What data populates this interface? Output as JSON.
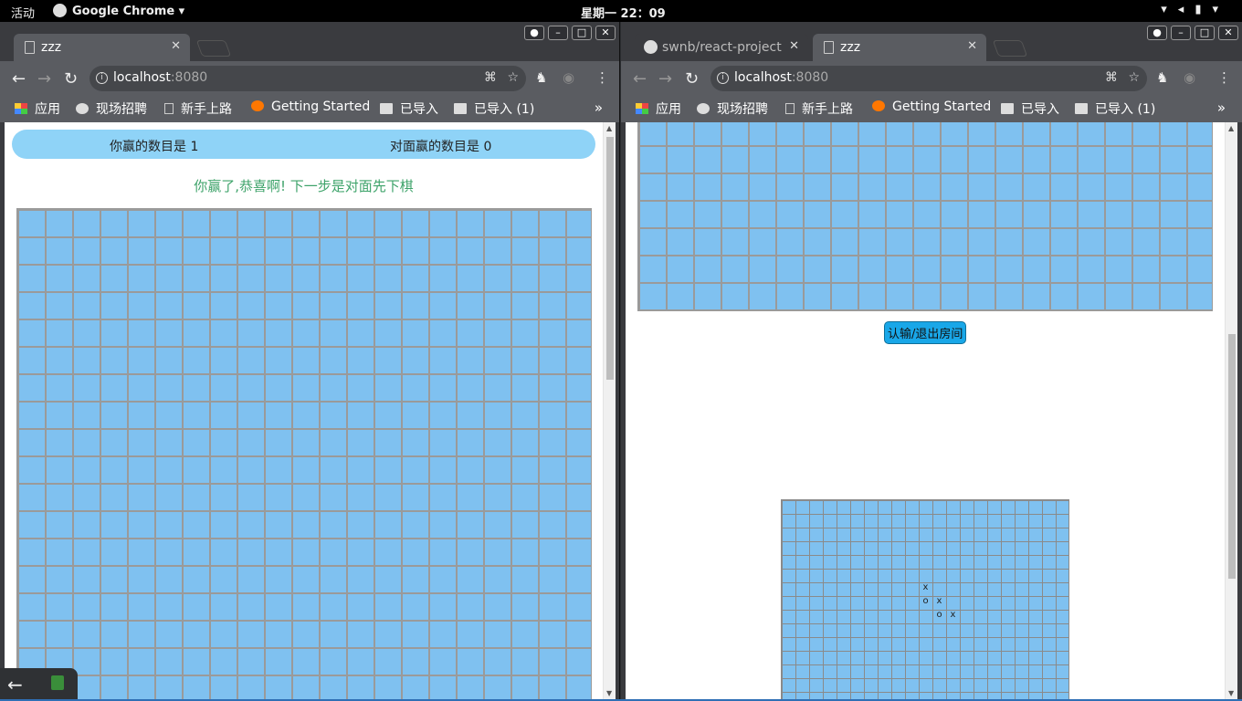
{
  "topbar": {
    "activities": "活动",
    "app_name": "Google Chrome",
    "clock": "星期一 22：09"
  },
  "left_window": {
    "tab": {
      "title": "zzz"
    },
    "url": {
      "host": "localhost",
      "port": ":8080"
    },
    "bookmarks": [
      "应用",
      "现场招聘",
      "新手上路",
      "Getting Started",
      "已导入",
      "已导入 (1)"
    ],
    "bookmarks_more": "»",
    "score": {
      "mine": "你赢的数目是 1",
      "opponent": "对面赢的数目是 0"
    },
    "status": "你赢了,恭喜啊! 下一步是对面先下棋"
  },
  "right_window": {
    "tabs": [
      {
        "title": "swnb/react-project"
      },
      {
        "title": "zzz"
      }
    ],
    "url": {
      "host": "localhost",
      "port": ":8080"
    },
    "bookmarks": [
      "应用",
      "现场招聘",
      "新手上路",
      "Getting Started",
      "已导入",
      "已导入 (1)"
    ],
    "bookmarks_more": "»",
    "resign_button": "认输/退出房间",
    "pieces": [
      "x",
      "o",
      "x",
      "o",
      "x"
    ]
  },
  "icons": {
    "back": "arrow-left-icon",
    "forward": "arrow-right-icon",
    "reload": "reload-icon",
    "translate": "translate-icon",
    "bookmark_star": "star-icon",
    "menu": "more-vert-icon"
  },
  "colors": {
    "board": "#7fc1f0",
    "grid": "#9a9a9a",
    "scorebar": "#8fd3f7",
    "status_text": "#3ea36a",
    "resign_button": "#19a7e8"
  }
}
